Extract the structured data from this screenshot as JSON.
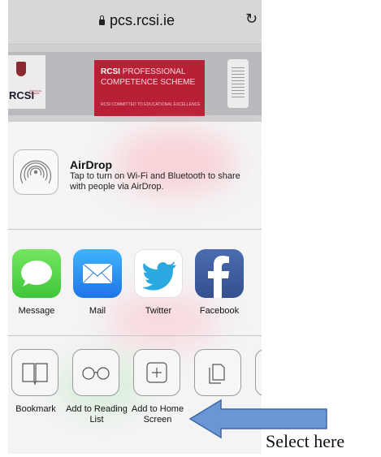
{
  "browser": {
    "url": "pcs.rcsi.ie"
  },
  "page_preview": {
    "logo_text": "RCSI",
    "logo_subtext": "SURGICAL AFFAIRS",
    "banner_bold": "RCSI",
    "banner_line1": "PROFESSIONAL",
    "banner_line2": "COMPETENCE SCHEME",
    "banner_tagline": "RCSI COMMITTED TO EDUCATIONAL EXCELLENCE"
  },
  "airdrop": {
    "title": "AirDrop",
    "description": "Tap to turn on Wi-Fi and Bluetooth to share with people via AirDrop."
  },
  "share_apps": [
    {
      "label": "Message",
      "icon": "message-icon",
      "color": "#5bd94e"
    },
    {
      "label": "Mail",
      "icon": "mail-icon",
      "color": "#2f8ff4"
    },
    {
      "label": "Twitter",
      "icon": "twitter-icon",
      "color": "#2aa9e0"
    },
    {
      "label": "Facebook",
      "icon": "facebook-icon",
      "color": "#3b5998"
    }
  ],
  "actions": [
    {
      "label": "Bookmark",
      "icon": "book-icon"
    },
    {
      "label": "Add to Reading List",
      "icon": "glasses-icon"
    },
    {
      "label": "Add to Home Screen",
      "icon": "plus-icon"
    },
    {
      "label": "",
      "icon": "copy-icon"
    }
  ],
  "annotation": {
    "text": "Select here",
    "arrow_color": "#6b96d6"
  }
}
